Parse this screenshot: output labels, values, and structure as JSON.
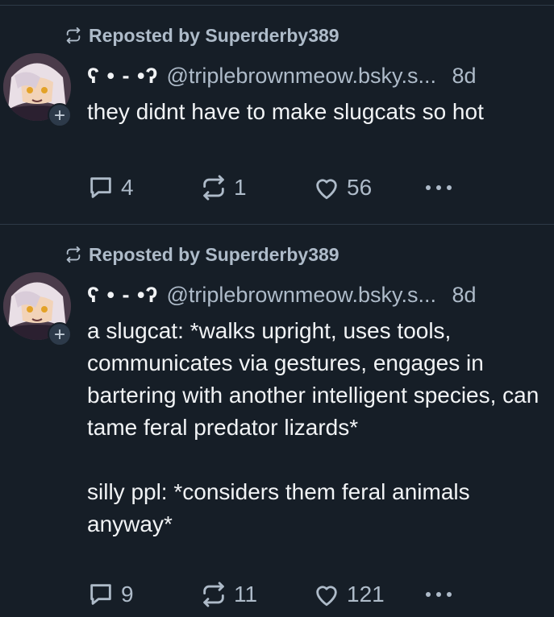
{
  "posts": [
    {
      "repost_text": "Reposted by Superderby389",
      "display_name": "ʕ • - •ʔ",
      "handle": "@triplebrownmeow.bsky.s...",
      "time": "8d",
      "text": "they didnt have to make slugcats so hot",
      "counts": {
        "replies": "4",
        "reposts": "1",
        "likes": "56"
      },
      "avatar_plus": "+"
    },
    {
      "repost_text": "Reposted by Superderby389",
      "display_name": "ʕ • - •ʔ",
      "handle": "@triplebrownmeow.bsky.s...",
      "time": "8d",
      "text": "a slugcat: *walks upright, uses tools, communicates via gestures, engages in bartering with another intelligent species, can tame feral predator lizards*\n\nsilly ppl: *considers them feral animals anyway*",
      "counts": {
        "replies": "9",
        "reposts": "11",
        "likes": "121"
      },
      "avatar_plus": "+"
    }
  ],
  "icons": {
    "repost": "repost-icon",
    "reply": "reply-bubble-icon",
    "like": "heart-icon",
    "more": "ellipsis-icon",
    "plus": "plus-icon"
  },
  "colors": {
    "background": "#161e27",
    "text_primary": "#f1f3f5",
    "text_secondary": "#aebbc9",
    "divider": "#2e3a47"
  }
}
